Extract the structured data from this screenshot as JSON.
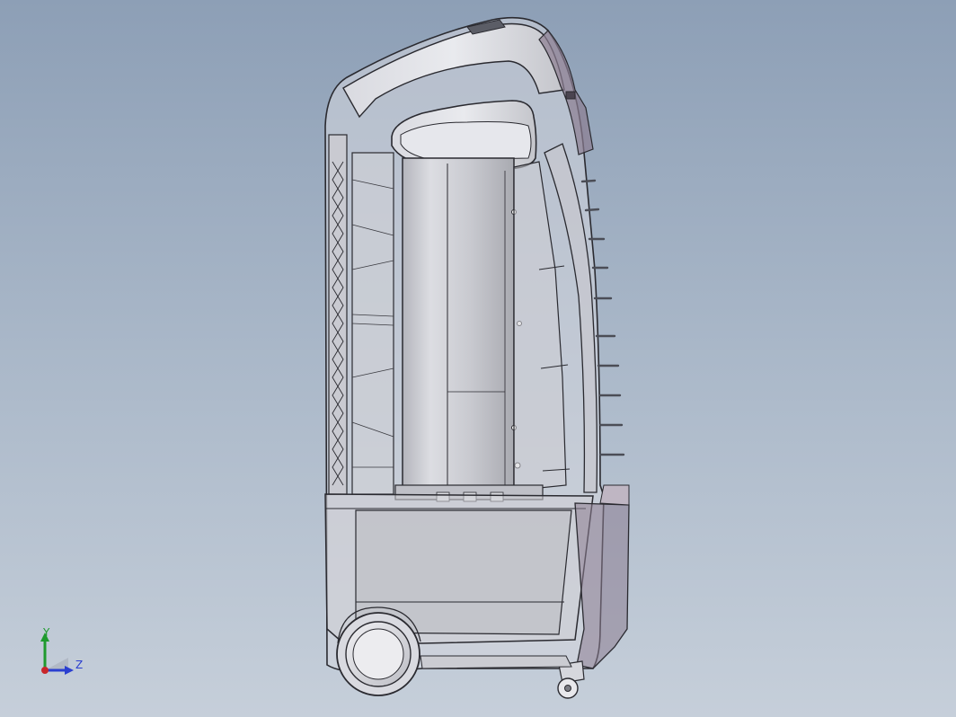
{
  "viewport": {
    "background_top": "#8d9fb6",
    "background_bottom": "#c6cfda"
  },
  "model": {
    "name": "portable-air-cooler",
    "view": "side",
    "display_mode": "shaded-with-edges-transparent",
    "body_color": "#dadbe2",
    "inner_color": "#c8c9cf",
    "edge_color": "#2a2a30",
    "accent_color": "#8c7d92"
  },
  "triad": {
    "y_label": "Y",
    "z_label": "Z",
    "y_color": "#1f9a2e",
    "z_color": "#2a3fd0",
    "x_color": "#c8262b"
  }
}
